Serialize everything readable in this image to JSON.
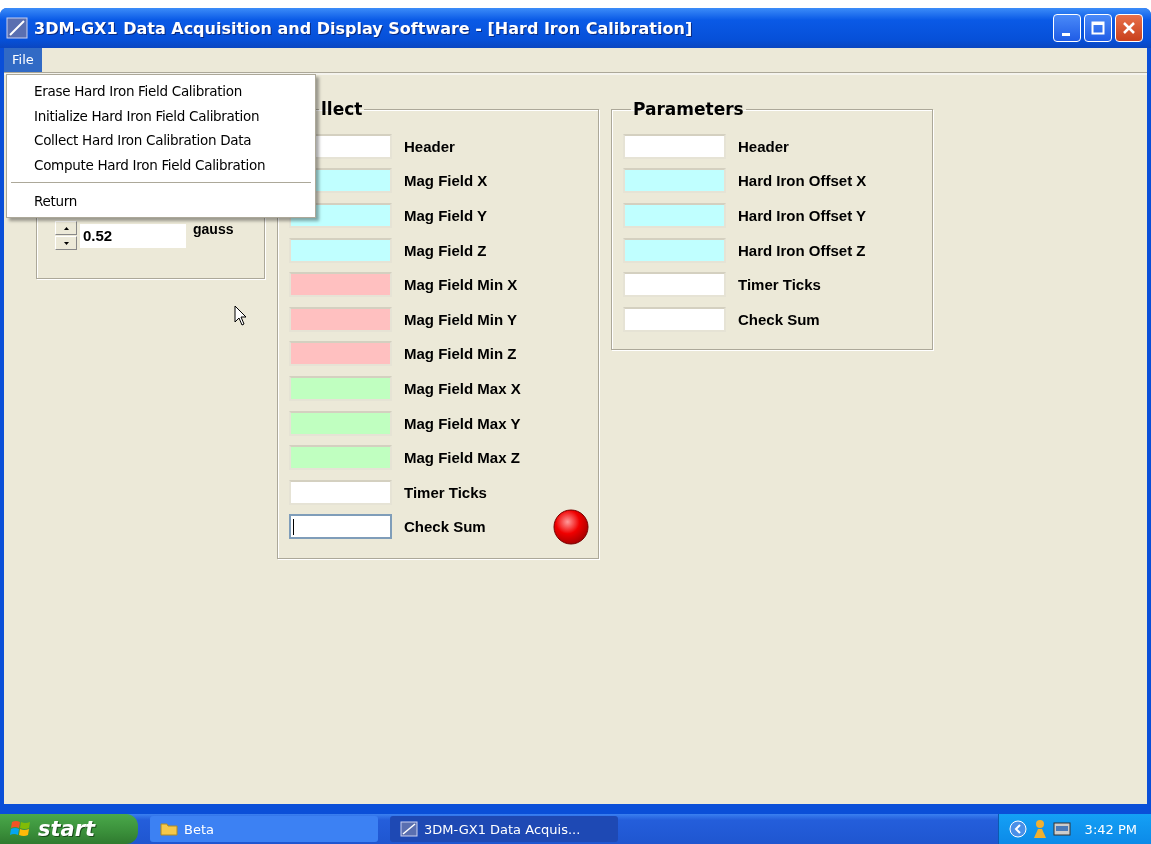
{
  "window": {
    "title": "3DM-GX1 Data Acquisition and Display Software - [Hard Iron Calibration]"
  },
  "menu_bar": [
    {
      "label": "File",
      "selected": true
    }
  ],
  "file_menu": [
    {
      "kind": "item",
      "label": "Erase Hard Iron Field Calibration"
    },
    {
      "kind": "item",
      "label": "Initialize Hard Iron Field Calibration"
    },
    {
      "kind": "item",
      "label": "Collect Hard Iron Calibration Data"
    },
    {
      "kind": "item",
      "label": "Compute Hard Iron Field Calibration"
    },
    {
      "kind": "separator"
    },
    {
      "kind": "item",
      "label": "Return"
    }
  ],
  "magnitude": {
    "value": "0.52",
    "unit": "gauss"
  },
  "collect": {
    "title": "llect",
    "led_on": true,
    "fields": [
      {
        "label": "Header",
        "color": "#ffffff"
      },
      {
        "label": "Mag Field X",
        "color": "#c0ffff"
      },
      {
        "label": "Mag Field Y",
        "color": "#c0ffff"
      },
      {
        "label": "Mag Field Z",
        "color": "#c0ffff"
      },
      {
        "label": "Mag Field Min X",
        "color": "#ffc0c0"
      },
      {
        "label": "Mag Field Min Y",
        "color": "#ffc0c0"
      },
      {
        "label": "Mag Field Min Z",
        "color": "#ffc0c0"
      },
      {
        "label": "Mag Field Max X",
        "color": "#c0ffc0"
      },
      {
        "label": "Mag Field Max Y",
        "color": "#c0ffc0"
      },
      {
        "label": "Mag Field Max Z",
        "color": "#c0ffc0"
      },
      {
        "label": "Timer Ticks",
        "color": "#ffffff"
      },
      {
        "label": "Check Sum",
        "color": "#ffffff",
        "focused": true
      }
    ]
  },
  "parameters": {
    "title": "Parameters",
    "fields": [
      {
        "label": "Header",
        "color": "#ffffff"
      },
      {
        "label": "Hard Iron Offset X",
        "color": "#c0ffff"
      },
      {
        "label": "Hard Iron Offset Y",
        "color": "#c0ffff"
      },
      {
        "label": "Hard Iron Offset Z",
        "color": "#c0ffff"
      },
      {
        "label": "Timer Ticks",
        "color": "#ffffff"
      },
      {
        "label": "Check Sum",
        "color": "#ffffff"
      }
    ]
  },
  "taskbar": {
    "start": "start",
    "tasks": [
      {
        "label": "Beta",
        "selected": false
      },
      {
        "label": "3DM-GX1 Data Acquis...",
        "selected": true
      }
    ],
    "clock": "3:42 PM"
  }
}
